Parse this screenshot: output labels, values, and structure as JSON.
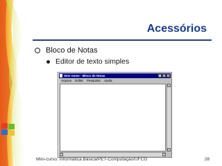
{
  "slide": {
    "title": "Acessórios",
    "bullet1": "Bloco de Notas",
    "bullet2": "Editor de texto simples"
  },
  "notepad": {
    "window_title": "Sem nome - Bloco de Notas",
    "menus": [
      "Arquivo",
      "Editar",
      "Pesquisar",
      "Ajuda"
    ]
  },
  "footer": {
    "left": "Mini-curso: Informática Básica/PET-Computação/UFCG",
    "page": "28"
  },
  "colors": {
    "title": "#123a8c",
    "rule": "#2a3f7a",
    "titlebar": "#000080"
  },
  "icons": {
    "logo": "windows-logo-icon"
  }
}
